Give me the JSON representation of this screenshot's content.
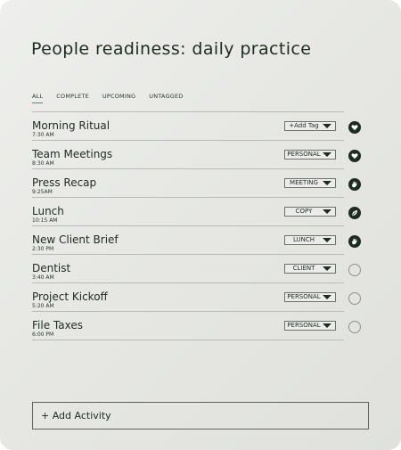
{
  "page": {
    "title": "People readiness: daily practice"
  },
  "tabs": [
    {
      "label": "ALL",
      "active": true
    },
    {
      "label": "COMPLETE",
      "active": false
    },
    {
      "label": "UPCOMING",
      "active": false
    },
    {
      "label": "UNTAGGED",
      "active": false
    }
  ],
  "activities": [
    {
      "name": "Morning Ritual",
      "time": "7:30 AM",
      "tag": "+Add Tag",
      "status": "done",
      "status_icon": "heart-icon"
    },
    {
      "name": "Team Meetings",
      "time": "8:30 AM",
      "tag": "PERSONAL",
      "status": "done",
      "status_icon": "heart-icon"
    },
    {
      "name": "Press Recap",
      "time": "9:25AM",
      "tag": "MEETING",
      "status": "done",
      "status_icon": "hand-icon"
    },
    {
      "name": "Lunch",
      "time": "10:15 AM",
      "tag": "COPY",
      "status": "done",
      "status_icon": "leaf-icon"
    },
    {
      "name": "New Client Brief",
      "time": "2:30 PM",
      "tag": "LUNCH",
      "status": "done",
      "status_icon": "hand-icon"
    },
    {
      "name": "Dentist",
      "time": "3:40 AM",
      "tag": "CLIENT",
      "status": "pending",
      "status_icon": "empty-circle-icon"
    },
    {
      "name": "Project Kickoff",
      "time": "5:20 AM",
      "tag": "PERSONAL",
      "status": "pending",
      "status_icon": "empty-circle-icon"
    },
    {
      "name": "File Taxes",
      "time": "6:00 PM",
      "tag": "PERSONAL",
      "status": "pending",
      "status_icon": "empty-circle-icon"
    }
  ],
  "add_activity": {
    "label": "+ Add Activity"
  },
  "colors": {
    "background": "#e6e7e3",
    "text": "#1f2a22",
    "accent_underline": "#3a9a78",
    "status_filled": "#1e2a22"
  }
}
